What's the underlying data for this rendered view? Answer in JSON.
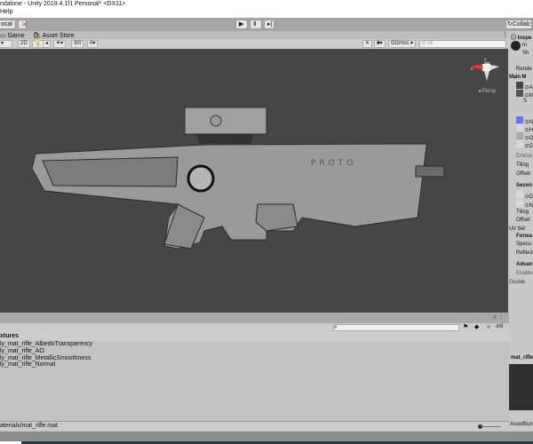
{
  "window": {
    "title": "ndalone - Unity 2019.4.1f1 Personal* <DX11>",
    "menu_help": "Help"
  },
  "toolbar": {
    "pivot_local": "ocal",
    "collab": "Collab"
  },
  "tabs": {
    "game": "Game",
    "asset_store": "Asset Store"
  },
  "scene_toolbar": {
    "mode_2d": "2D",
    "effects_count": "0",
    "gizmos": "Gizmos",
    "search_placeholder": "All"
  },
  "scene": {
    "persp_label": "Persp",
    "gizmo_x": "x",
    "gizmo_y": "y",
    "model_text": "PROTO"
  },
  "inspector": {
    "tab": "Inspe",
    "material_name": "m",
    "shader": "Sh",
    "items": [
      "Rende",
      "Main M",
      "A",
      "M",
      "S",
      "N",
      "H",
      "O",
      "D",
      "Emissi",
      "Tiling",
      "Offset",
      "Secon",
      "D",
      "N",
      "Tiling",
      "Offset",
      "UV Set",
      "Forwa",
      "Specu",
      "Reflect",
      "Advan",
      "Enable",
      "Double"
    ],
    "color_albedo": "#7070ff"
  },
  "project": {
    "breadcrumb": "xtures",
    "items": [
      "ly_mat_rifle_AlbedoTransparency",
      "ly_mat_rifle_AO",
      "ly_mat_rifle_MetallicSmoothness",
      "ly_mat_rifle_Normal"
    ],
    "path": "aterials/mat_rifle.mat",
    "hidden_count": "8"
  },
  "preview": {
    "title": "mat_rifle",
    "assetbundle": "AssetBun"
  }
}
